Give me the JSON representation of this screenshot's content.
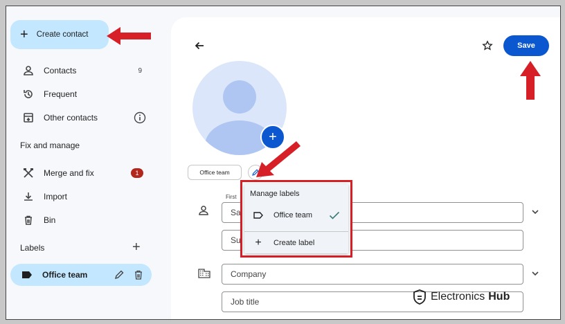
{
  "sidebar": {
    "create_label": "Create contact",
    "items": [
      {
        "label": "Contacts",
        "icon": "person-icon",
        "count": "9"
      },
      {
        "label": "Frequent",
        "icon": "history-icon"
      },
      {
        "label": "Other contacts",
        "icon": "archive-download-icon"
      }
    ],
    "fix_heading": "Fix and manage",
    "fix_items": [
      {
        "label": "Merge and fix",
        "icon": "merge-icon",
        "badge": "1"
      },
      {
        "label": "Import",
        "icon": "download-icon"
      },
      {
        "label": "Bin",
        "icon": "trash-icon"
      }
    ],
    "labels_heading": "Labels",
    "label_items": [
      {
        "label": "Office team",
        "icon": "label-icon"
      }
    ]
  },
  "toolbar": {
    "save_label": "Save"
  },
  "contact": {
    "label_chip": "Office team",
    "fields": {
      "first_name_label": "First",
      "first_name_value": "Sar",
      "surname_value": "Sur",
      "company_placeholder": "Company",
      "job_title_placeholder": "Job title"
    }
  },
  "dropdown": {
    "title": "Manage labels",
    "items": [
      {
        "label": "Office team",
        "icon": "label-outline-icon",
        "checked": true
      },
      {
        "label": "Create label",
        "icon": "plus-icon"
      }
    ]
  },
  "watermark": {
    "part1": "Electronics",
    "part2": "Hub"
  },
  "colors": {
    "accent": "#0b57d0",
    "selected": "#c2e7ff",
    "badge": "#b3261e",
    "annotation_red": "#d61f26"
  }
}
